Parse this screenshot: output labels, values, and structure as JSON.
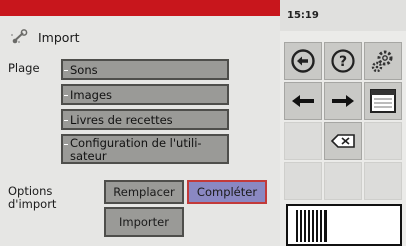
{
  "header": {
    "title": "Import",
    "icon": "wrench-icon",
    "accent_color": "#c8161c"
  },
  "range": {
    "label": "Plage",
    "items": [
      {
        "label": "Sons"
      },
      {
        "label": "Images"
      },
      {
        "label": "Livres de recettes"
      },
      {
        "label": "Configuration de l'utili-\nsateur"
      }
    ]
  },
  "options": {
    "label": "Options\nd'import",
    "replace_label": "Remplacer",
    "complete_label": "Compléter",
    "selected": "Compléter",
    "selected_color": "#8a88c2",
    "selected_border_color": "#c23a3a"
  },
  "actions": {
    "import_label": "Importer"
  },
  "status": {
    "time": "15:19"
  },
  "side_keys": [
    {
      "icon": "back-circle-icon"
    },
    {
      "icon": "help-icon"
    },
    {
      "icon": "settings-icon"
    },
    {
      "icon": "arrow-left-icon"
    },
    {
      "icon": "arrow-right-icon"
    },
    {
      "icon": "window-icon"
    },
    {
      "icon": "backspace-icon"
    }
  ],
  "logo": {
    "icon": "barcode-logo"
  }
}
